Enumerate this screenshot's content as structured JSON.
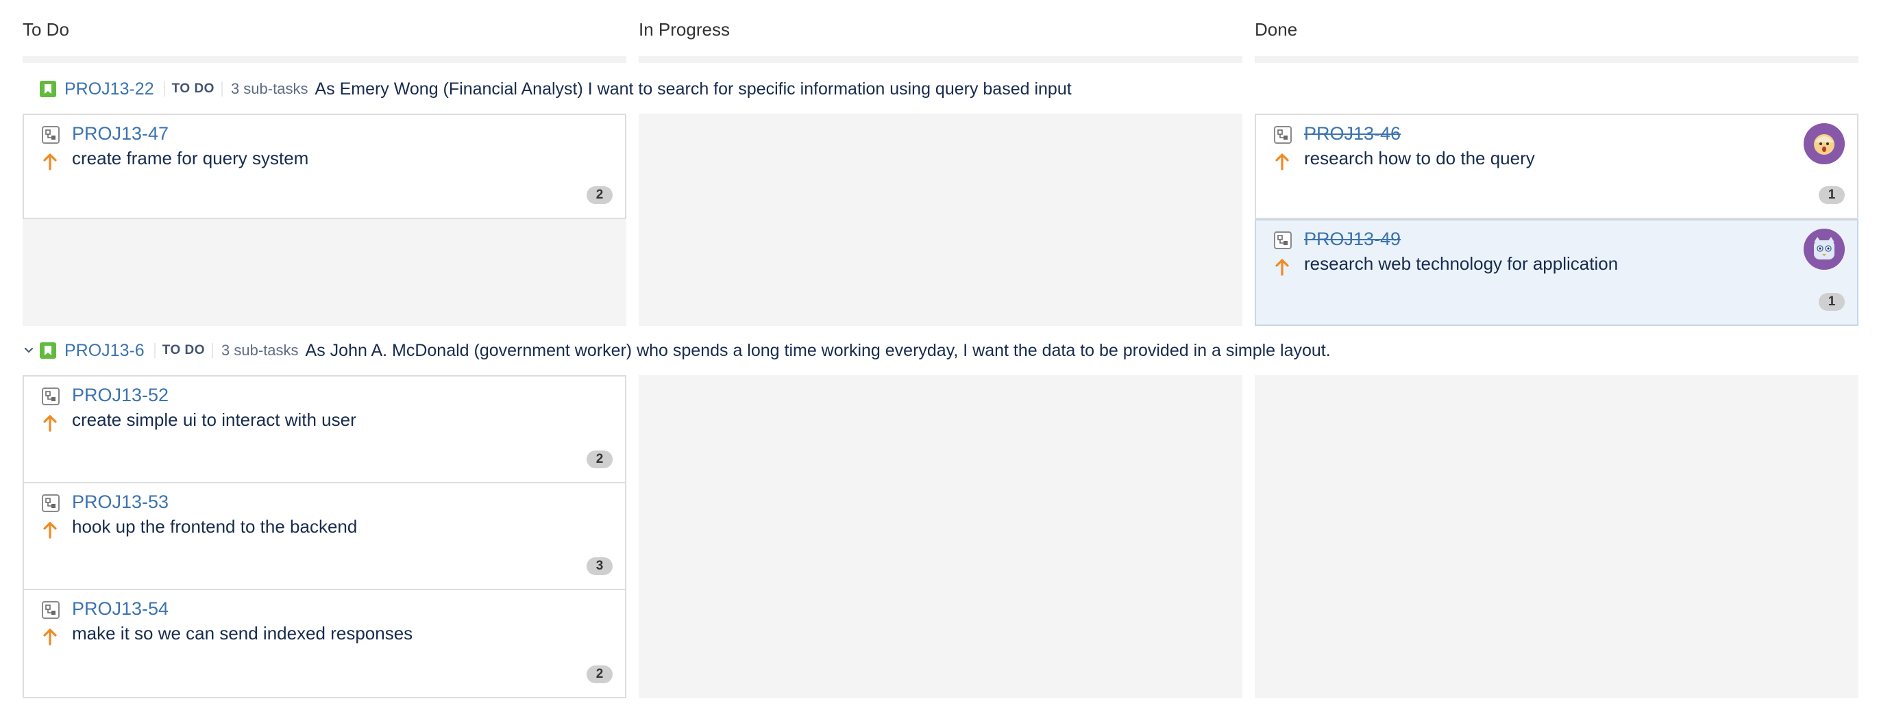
{
  "columns": [
    {
      "title": "To Do"
    },
    {
      "title": "In Progress"
    },
    {
      "title": "Done"
    }
  ],
  "swimlanes": [
    {
      "key": "PROJ13-22",
      "status": "TO DO",
      "subtasks": "3 sub-tasks",
      "summary": "As Emery Wong (Financial Analyst) I want to search for specific information using query based input",
      "cards": {
        "todo": [
          {
            "key": "PROJ13-47",
            "summary": "create frame for query system",
            "badge": "2"
          }
        ],
        "done": [
          {
            "key": "PROJ13-46",
            "summary": "research how to do the query",
            "badge": "1"
          },
          {
            "key": "PROJ13-49",
            "summary": "research web technology for application",
            "badge": "1"
          }
        ]
      }
    },
    {
      "key": "PROJ13-6",
      "status": "TO DO",
      "subtasks": "3 sub-tasks",
      "summary": "As John A. McDonald (government worker) who spends a long time working everyday, I want the data to be provided in a simple layout.",
      "cards": {
        "todo": [
          {
            "key": "PROJ13-52",
            "summary": "create simple ui to interact with user",
            "badge": "2"
          },
          {
            "key": "PROJ13-53",
            "summary": "hook up the frontend to the backend",
            "badge": "3"
          },
          {
            "key": "PROJ13-54",
            "summary": "make it so we can send indexed responses",
            "badge": "2"
          }
        ]
      }
    }
  ],
  "colors": {
    "link": "#3b73af",
    "story": "#63ba3c",
    "priority": "#f08a24",
    "lane_bg": "#f4f4f4",
    "selected_card": "#ebf2f9",
    "avatar_bg": "#8858a8"
  },
  "icons": {
    "story": "bookmark-icon",
    "subtask": "subtask-icon",
    "priority": "priority-arrow-up-icon",
    "collapse": "chevron-down-icon"
  }
}
